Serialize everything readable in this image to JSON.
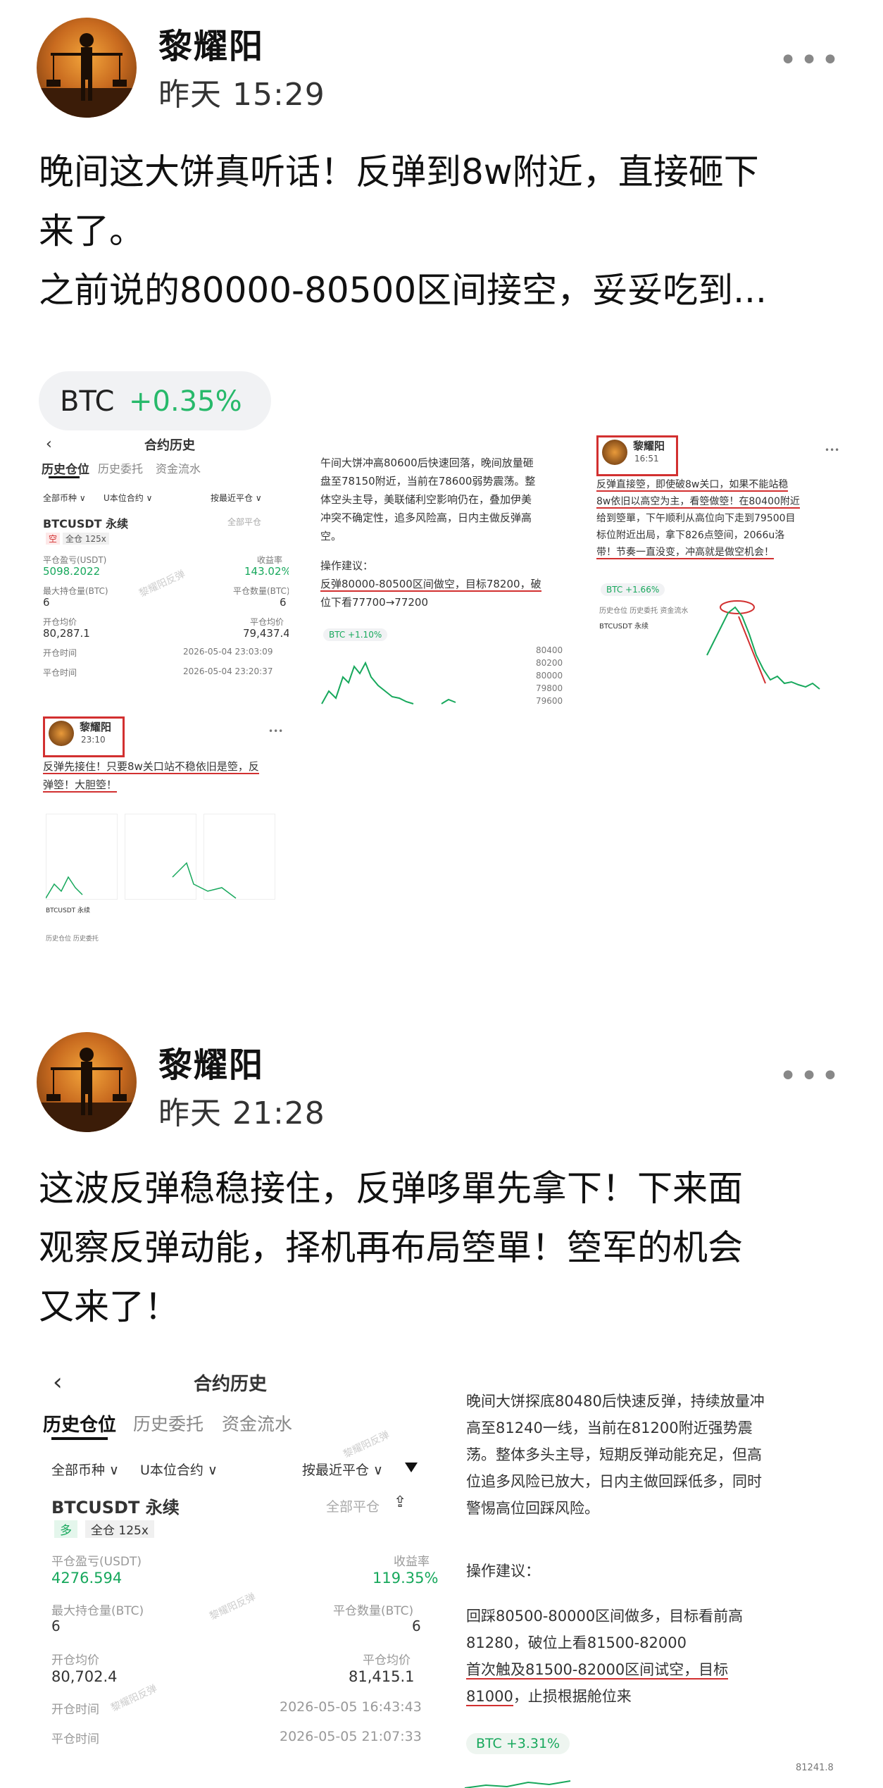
{
  "posts": [
    {
      "author": "黎耀阳",
      "time": "昨天 15:29",
      "text_lines": [
        "晚间这大饼真听话！反弹到8w附近，直接砸下",
        "来了。",
        "之前说的80000-80500区间接空，妥妥吃到..."
      ],
      "chip": {
        "symbol": "BTC",
        "change": "+0.35%"
      },
      "more_label": "•••"
    },
    {
      "author": "黎耀阳",
      "time": "昨天 21:28",
      "text_lines": [
        "这波反弹稳稳接住，反弹哆單先拿下！下来面",
        "观察反弹动能，择机再布局箜單！箜军的机会",
        "又来了！"
      ],
      "more_label": "•••"
    }
  ],
  "thumb1": {
    "title": "合约历史",
    "tabs": [
      "历史仓位",
      "历史委托",
      "资金流水"
    ],
    "filters": [
      "全部币种 ∨",
      "U本位合约 ∨",
      "按最近平仓 ∨"
    ],
    "contract": "BTCUSDT 永续",
    "all_close": "全部平仓",
    "tags": [
      "空",
      "全仓 125x"
    ],
    "labels": [
      "平仓盈亏(USDT)",
      "收益率",
      "最大持仓量(BTC)",
      "平仓数量(BTC)",
      "开仓均价",
      "平仓均价",
      "开仓时间",
      "平仓时间"
    ],
    "values": [
      "5098.2022",
      "143.02%",
      "6",
      "6",
      "80,287.1",
      "79,437.4",
      "2026-05-04 23:03:09",
      "2026-05-04 23:20:37"
    ]
  },
  "thumb2": {
    "lines": [
      "午间大饼冲高80600后快速回落，晚间放量砸",
      "盘至78150附近，当前在78600弱势震荡。整",
      "体空头主导，美联储利空影响仍在，叠加伊美",
      "冲突不确定性，追多风险高，日内主做反弹高",
      "空。"
    ],
    "advice_title": "操作建议：",
    "advice_1": "反弹80000-80500区间做空，目标78200，破",
    "advice_2": "位下看77700→77200",
    "chip": "BTC +1.10%",
    "axis": [
      "80400",
      "80200",
      "80000",
      "79800",
      "79600"
    ]
  },
  "thumb3": {
    "author": "黎耀阳",
    "time": "16:51",
    "lines": [
      "反弹直接箜，即使破8w关口，如果不能站稳",
      "8w依旧以高空为主，看箜做箜！在80400附近",
      "给到箜單，下午顺利从高位向下走到79500目",
      "标位附近出局，拿下826点箜间，2066u洛",
      "带！节奏一直没变，冲高就是做空机会！"
    ],
    "chip": "BTC +1.66%",
    "contract": "BTCUSDT 永续",
    "tabs": [
      "历史仓位",
      "历史委托",
      "资金流水"
    ]
  },
  "thumb4": {
    "author": "黎耀阳",
    "time": "23:10",
    "lines": [
      "反弹先接住！只要8w关口站不稳依旧是箜，反",
      "弹箜！大胆箜！"
    ],
    "contract": "BTCUSDT 永续",
    "tabs": [
      "历史仓位",
      "历史委托"
    ]
  },
  "thumb5": {
    "title": "合约历史",
    "tabs": [
      "历史仓位",
      "历史委托",
      "资金流水"
    ],
    "filters": [
      "全部币种 ∨",
      "U本位合约 ∨",
      "按最近平仓 ∨"
    ],
    "contract": "BTCUSDT 永续",
    "all_close": "全部平仓",
    "tags": [
      "多",
      "全仓 125x"
    ],
    "labels": [
      "平仓盈亏(USDT)",
      "收益率",
      "最大持仓量(BTC)",
      "平仓数量(BTC)",
      "开仓均价",
      "平仓均价",
      "开仓时间",
      "平仓时间"
    ],
    "values": [
      "4276.594",
      "119.35%",
      "6",
      "6",
      "80,702.4",
      "81,415.1",
      "2026-05-05 16:43:43",
      "2026-05-05 21:07:33"
    ]
  },
  "thumb6": {
    "lines": [
      "晚间大饼探底80480后快速反弹，持续放量冲",
      "高至81240一线，当前在81200附近强势震",
      "荡。整体多头主导，短期反弹动能充足，但高",
      "位追多风险已放大，日内主做回踩低多，同时",
      "警惕高位回踩风险。"
    ],
    "advice_title": "操作建议：",
    "advice_lines": [
      "回踩80500-80000区间做多，目标看前高",
      "81280，破位上看81500-82000"
    ],
    "advice_red_1": "首次触及81500-82000区间试空，目标",
    "advice_red_2": "81000",
    "advice_tail": "，止损根据舱位来",
    "chip": "BTC +3.31%",
    "axis_top": "81241.8"
  },
  "watermark": "黎耀阳反弹"
}
